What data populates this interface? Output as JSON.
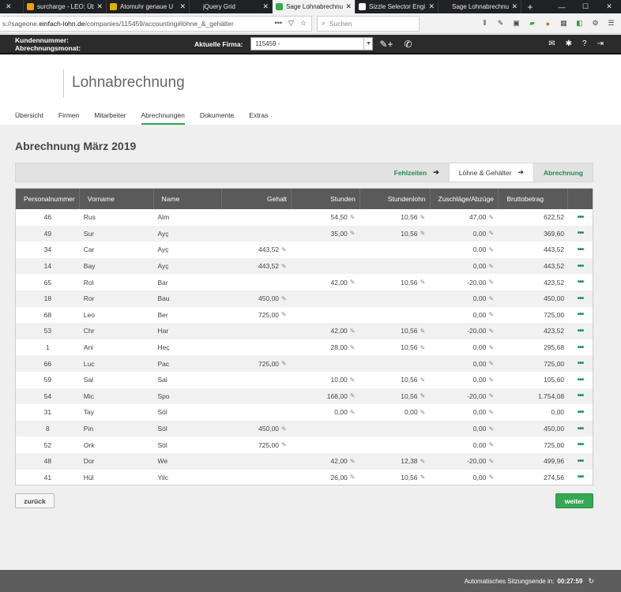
{
  "browser": {
    "tabs": [
      {
        "title": "",
        "active": false,
        "fav_color": ""
      },
      {
        "title": "surcharge - LEO: Üb",
        "active": false,
        "fav_color": "#f0a000"
      },
      {
        "title": "Atomuhr genaue U",
        "active": false,
        "fav_color": "#e0b000"
      },
      {
        "title": "jQuery Grid",
        "active": false,
        "fav_color": ""
      },
      {
        "title": "Sage Lohnabrechnu",
        "active": true,
        "fav_color": "#34a853"
      },
      {
        "title": "Sizzle Selector Engi",
        "active": false,
        "fav_color": "#ffffff"
      },
      {
        "title": "Sage Lohnabrechnung",
        "active": false,
        "fav_color": ""
      }
    ],
    "url_prefix": "s://sageone.",
    "url_host": "einfach-lohn.de",
    "url_path": "/companies/115459/accounting#löhne_&_gehälter",
    "search_placeholder": "Suchen"
  },
  "header": {
    "kundennummer_label": "Kundennummer:",
    "abrechnungsmonat_label": "Abrechnungsmonat:",
    "firma_label": "Aktuelle Firma:",
    "firma_value": "115459 -"
  },
  "brand": {
    "title": "Lohnabrechnung"
  },
  "nav": {
    "items": [
      "Übersicht",
      "Firmen",
      "Mitarbeiter",
      "Abrechnungen",
      "Dokumente",
      "Extras"
    ],
    "active_index": 3
  },
  "page": {
    "title": "Abrechnung März 2019",
    "steps": [
      {
        "label": "Fehlzeiten",
        "current": false
      },
      {
        "label": "Löhne & Gehälter",
        "current": true
      },
      {
        "label": "Abrechnung",
        "current": false
      }
    ]
  },
  "table": {
    "columns": [
      "Personalnummer",
      "Vorname",
      "Name",
      "Gehalt",
      "Stunden",
      "Stundenlohn",
      "Zuschläge/Abzüge",
      "Bruttobetrag",
      ""
    ],
    "rows": [
      {
        "nr": "46",
        "vorname": "Rus",
        "name": "Alm",
        "gehalt": "",
        "stunden": "54,50",
        "stundenlohn": "10,56",
        "zuschlaege": "47,00",
        "brutto": "622,52"
      },
      {
        "nr": "49",
        "vorname": "Sur",
        "name": "Ayç",
        "gehalt": "",
        "stunden": "35,00",
        "stundenlohn": "10,56",
        "zuschlaege": "0,00",
        "brutto": "369,60"
      },
      {
        "nr": "34",
        "vorname": "Car",
        "name": "Ayç",
        "gehalt": "443,52",
        "stunden": "",
        "stundenlohn": "",
        "zuschlaege": "0,00",
        "brutto": "443,52"
      },
      {
        "nr": "14",
        "vorname": "Bay",
        "name": "Ayç",
        "gehalt": "443,52",
        "stunden": "",
        "stundenlohn": "",
        "zuschlaege": "0,00",
        "brutto": "443,52"
      },
      {
        "nr": "65",
        "vorname": "Rol",
        "name": "Bar",
        "gehalt": "",
        "stunden": "42,00",
        "stundenlohn": "10,56",
        "zuschlaege": "-20,00",
        "brutto": "423,52"
      },
      {
        "nr": "18",
        "vorname": "Ror",
        "name": "Bau",
        "gehalt": "450,00",
        "stunden": "",
        "stundenlohn": "",
        "zuschlaege": "0,00",
        "brutto": "450,00"
      },
      {
        "nr": "68",
        "vorname": "Leo",
        "name": "Ber",
        "gehalt": "725,00",
        "stunden": "",
        "stundenlohn": "",
        "zuschlaege": "0,00",
        "brutto": "725,00"
      },
      {
        "nr": "53",
        "vorname": "Chr",
        "name": "Har",
        "gehalt": "",
        "stunden": "42,00",
        "stundenlohn": "10,56",
        "zuschlaege": "-20,00",
        "brutto": "423,52"
      },
      {
        "nr": "1",
        "vorname": "Ani",
        "name": "Heç",
        "gehalt": "",
        "stunden": "28,00",
        "stundenlohn": "10,56",
        "zuschlaege": "0,00",
        "brutto": "295,68"
      },
      {
        "nr": "66",
        "vorname": "Luc",
        "name": "Pac",
        "gehalt": "725,00",
        "stunden": "",
        "stundenlohn": "",
        "zuschlaege": "0,00",
        "brutto": "725,00"
      },
      {
        "nr": "59",
        "vorname": "Sal",
        "name": "Sal",
        "gehalt": "",
        "stunden": "10,00",
        "stundenlohn": "10,56",
        "zuschlaege": "0,00",
        "brutto": "105,60"
      },
      {
        "nr": "54",
        "vorname": "Mic",
        "name": "Spo",
        "gehalt": "",
        "stunden": "168,00",
        "stundenlohn": "10,56",
        "zuschlaege": "-20,00",
        "brutto": "1.754,08"
      },
      {
        "nr": "31",
        "vorname": "Tay",
        "name": "Söl",
        "gehalt": "",
        "stunden": "0,00",
        "stundenlohn": "0,00",
        "zuschlaege": "0,00",
        "brutto": "0,00"
      },
      {
        "nr": "8",
        "vorname": "Pin",
        "name": "Söl",
        "gehalt": "450,00",
        "stunden": "",
        "stundenlohn": "",
        "zuschlaege": "0,00",
        "brutto": "450,00"
      },
      {
        "nr": "52",
        "vorname": "Ork",
        "name": "Söl",
        "gehalt": "725,00",
        "stunden": "",
        "stundenlohn": "",
        "zuschlaege": "0,00",
        "brutto": "725,00"
      },
      {
        "nr": "48",
        "vorname": "Dor",
        "name": "We",
        "gehalt": "",
        "stunden": "42,00",
        "stundenlohn": "12,38",
        "zuschlaege": "-20,00",
        "brutto": "499,96"
      },
      {
        "nr": "41",
        "vorname": "Hül",
        "name": "Yilc",
        "gehalt": "",
        "stunden": "26,00",
        "stundenlohn": "10,56",
        "zuschlaege": "0,00",
        "brutto": "274,56"
      }
    ]
  },
  "buttons": {
    "back": "zurück",
    "next": "weiter"
  },
  "footer": {
    "label": "Automatisches Sitzungsende in:",
    "timer": "00:27:59"
  }
}
